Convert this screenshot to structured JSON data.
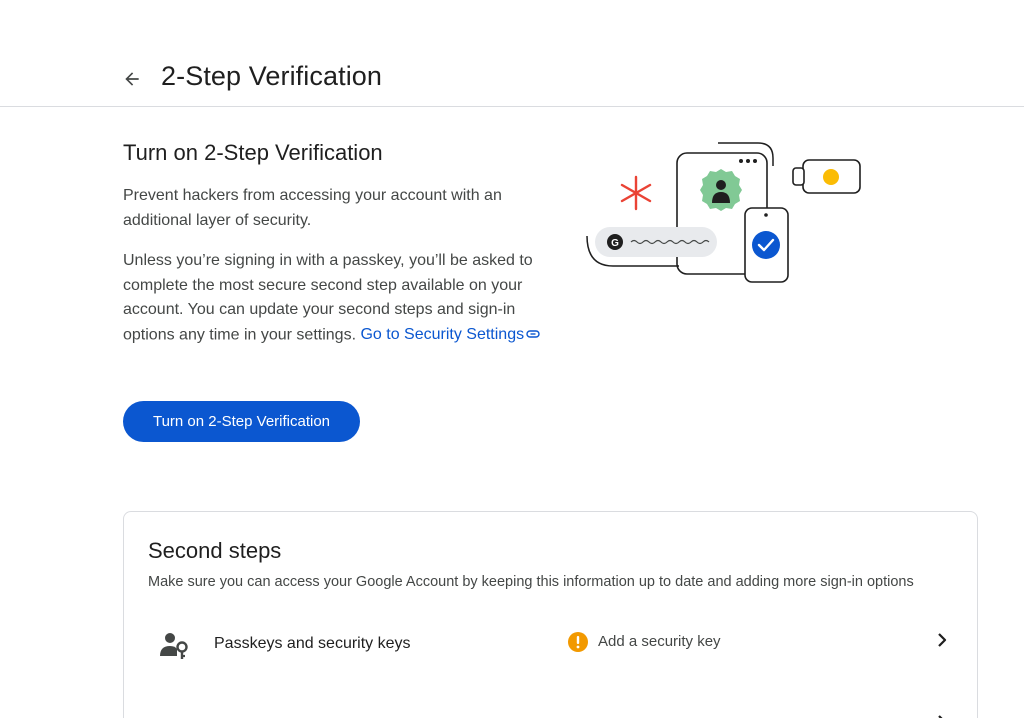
{
  "header": {
    "title": "2-Step Verification",
    "back_icon": "arrow-back-icon"
  },
  "intro": {
    "heading": "Turn on 2-Step Verification",
    "paragraph1": "Prevent hackers from accessing your account with an additional layer of security.",
    "paragraph2": "Unless you’re signing in with a passkey, you’ll be asked to complete the most secure second step available on your account. You can update your second steps and sign-in options any time in your settings.",
    "link_text": "Go to Security Settings",
    "link_icon": "link-icon",
    "button_label": "Turn on 2-Step Verification"
  },
  "illustration": {
    "name": "security-illustration"
  },
  "second_steps": {
    "title": "Second steps",
    "subtitle": "Make sure you can access your Google Account by keeping this information up to date and adding more sign-in options",
    "items": [
      {
        "label": "Passkeys and security keys",
        "icon": "person-key-icon",
        "status": "Add a security key",
        "status_icon": "warning-icon",
        "status_color": "#f29900"
      }
    ]
  },
  "colors": {
    "primary": "#0b57d0",
    "text": "#1f1f1f",
    "secondary_text": "#444746",
    "divider": "#dadce0",
    "warning": "#f29900",
    "illustration_red": "#ea4335",
    "illustration_green": "#81c995",
    "illustration_yellow": "#fbbc04",
    "illustration_blue": "#0b57d0"
  }
}
